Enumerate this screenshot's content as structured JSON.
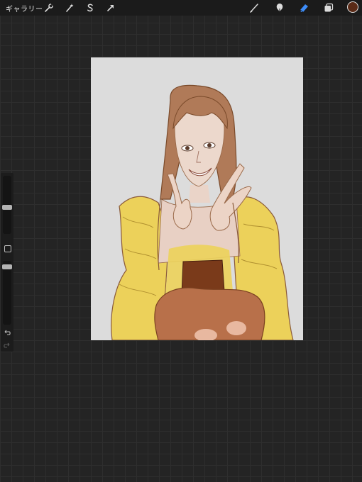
{
  "toolbar": {
    "gallery_label": "ギャラリー",
    "actions_icon": "wrench-icon",
    "adjustments_icon": "magic-wand-icon",
    "selection_icon": "selection-s-icon",
    "transform_icon": "arrow-cursor-icon",
    "brush_icon": "brush-icon",
    "smudge_icon": "smudge-icon",
    "eraser_icon": "eraser-icon",
    "layers_icon": "layers-icon",
    "current_color": "#5a2a16",
    "active_tool_color": "#3d8dfa"
  },
  "sidebar": {
    "brush_size_level": 0.46,
    "opacity_level": 0.06,
    "modify_icon": "square-modify-icon",
    "undo_icon": "undo-arrow-icon",
    "redo_icon": "redo-arrow-icon"
  },
  "canvas": {
    "background": "#dcdcdc",
    "artwork": "sketch-of-smiling-girl-in-yellow-dress"
  }
}
